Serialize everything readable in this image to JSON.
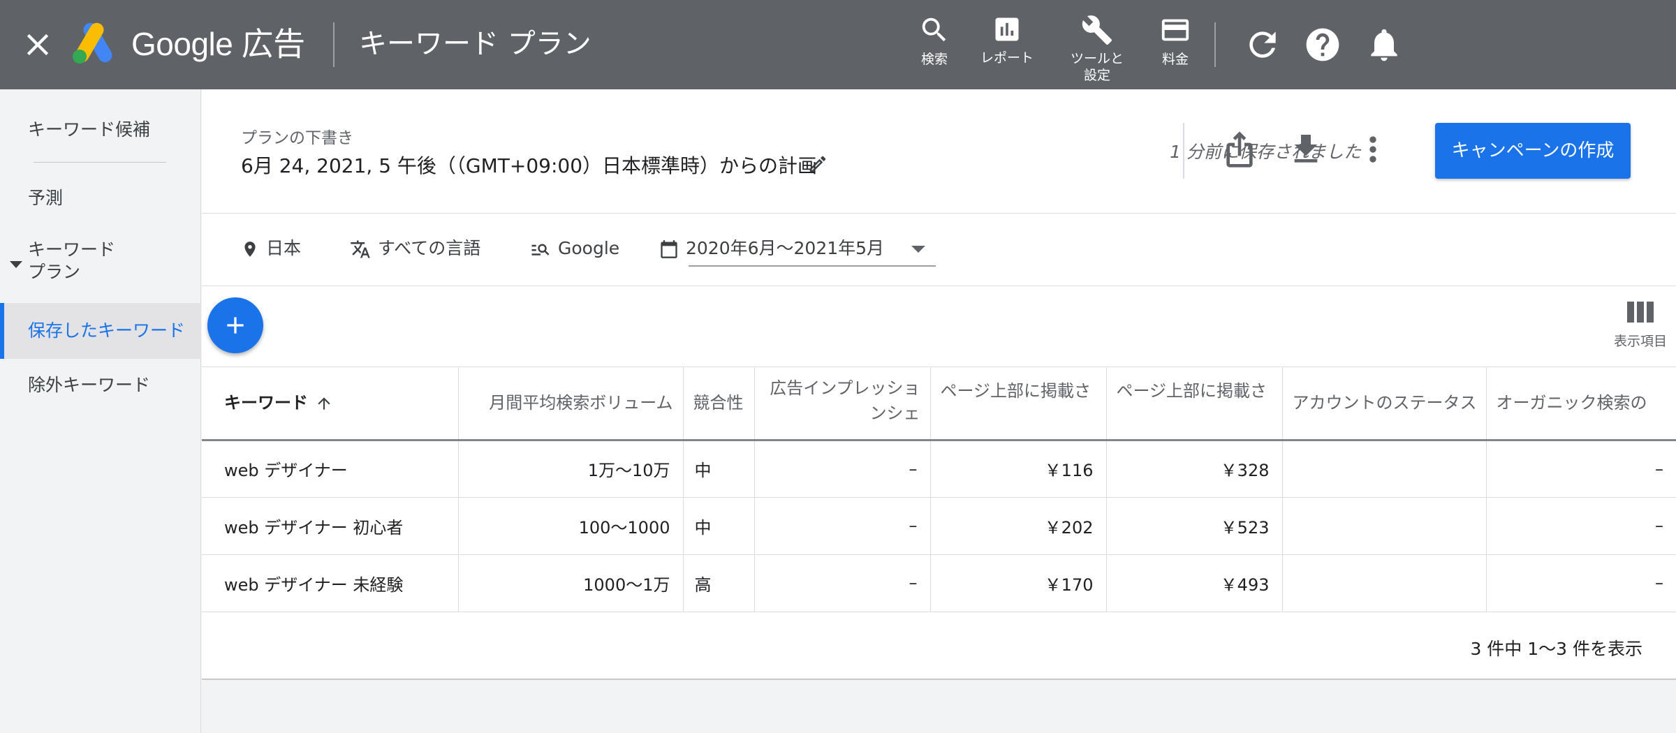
{
  "topbar": {
    "brand": "Google 広告",
    "page_title": "キーワード プラン",
    "tools": [
      {
        "label": "検索",
        "icon": "search-icon"
      },
      {
        "label": "レポート",
        "icon": "report-icon"
      },
      {
        "label": "ツールと\n設定",
        "icon": "wrench-icon"
      },
      {
        "label": "料金",
        "icon": "credit-card-icon"
      }
    ],
    "utility_icons": [
      "refresh-icon",
      "help-icon",
      "notifications-icon"
    ]
  },
  "sidebar": {
    "items": [
      {
        "label": "キーワード候補"
      },
      {
        "label": "予測"
      },
      {
        "label": "キーワード\nプラン"
      },
      {
        "label": "保存したキーワード",
        "active": true
      },
      {
        "label": "除外キーワード"
      }
    ]
  },
  "plan": {
    "draft_label": "プランの下書き",
    "name": "6月 24, 2021, 5 午後（（GMT+09:00）日本標準時）からの計画",
    "saved_status": "1 分前に保存されました",
    "create_campaign": "キャンペーンの作成"
  },
  "filters": {
    "location": "日本",
    "language": "すべての言語",
    "network": "Google",
    "date_range": "2020年6月〜2021年5月"
  },
  "toolbar": {
    "columns_label": "表示項目"
  },
  "table": {
    "headers": [
      "キーワード",
      "月間平均検索ボリューム",
      "競合性",
      "広告インプレッションシェ",
      "ページ上部に掲載さ",
      "ページ上部に掲載さ",
      "アカウントのステータス",
      "オーガニック検索の"
    ],
    "rows": [
      [
        "web デザイナー",
        "1万〜10万",
        "中",
        "–",
        "￥116",
        "￥328",
        "",
        "–"
      ],
      [
        "web デザイナー 初心者",
        "100〜1000",
        "中",
        "–",
        "￥202",
        "￥523",
        "",
        "–"
      ],
      [
        "web デザイナー 未経験",
        "1000〜1万",
        "高",
        "–",
        "￥170",
        "￥493",
        "",
        "–"
      ]
    ]
  },
  "pagination": "3 件中 1〜3 件を表示",
  "colors": {
    "topbar": "#5f6368",
    "accent": "#1a73e8",
    "google_blue": "#4285f4",
    "google_yellow": "#fbbc04",
    "google_green": "#34a853"
  }
}
